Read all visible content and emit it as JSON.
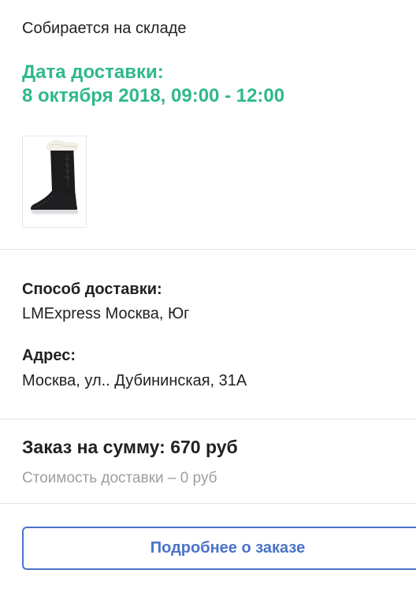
{
  "order": {
    "status": "Собирается на складе",
    "delivery_date_label": "Дата доставки:",
    "delivery_date_value": "8 октября 2018, 09:00 - 12:00",
    "product_image_icon": "winter-boot-image"
  },
  "delivery": {
    "method_label": "Способ доставки:",
    "method_value": "LMExpress Москва, Юг",
    "address_label": "Адрес:",
    "address_value": "Москва, ул.. Дубининская, 31А"
  },
  "summary": {
    "total": "Заказ на сумму: 670 руб",
    "delivery_cost": "Стоимость доставки – 0 руб"
  },
  "actions": {
    "details_button_label": "Подробнее о заказе"
  },
  "colors": {
    "accent_green": "#2fb88c",
    "link_blue": "#4a73c8",
    "muted_gray": "#9e9e9e"
  }
}
